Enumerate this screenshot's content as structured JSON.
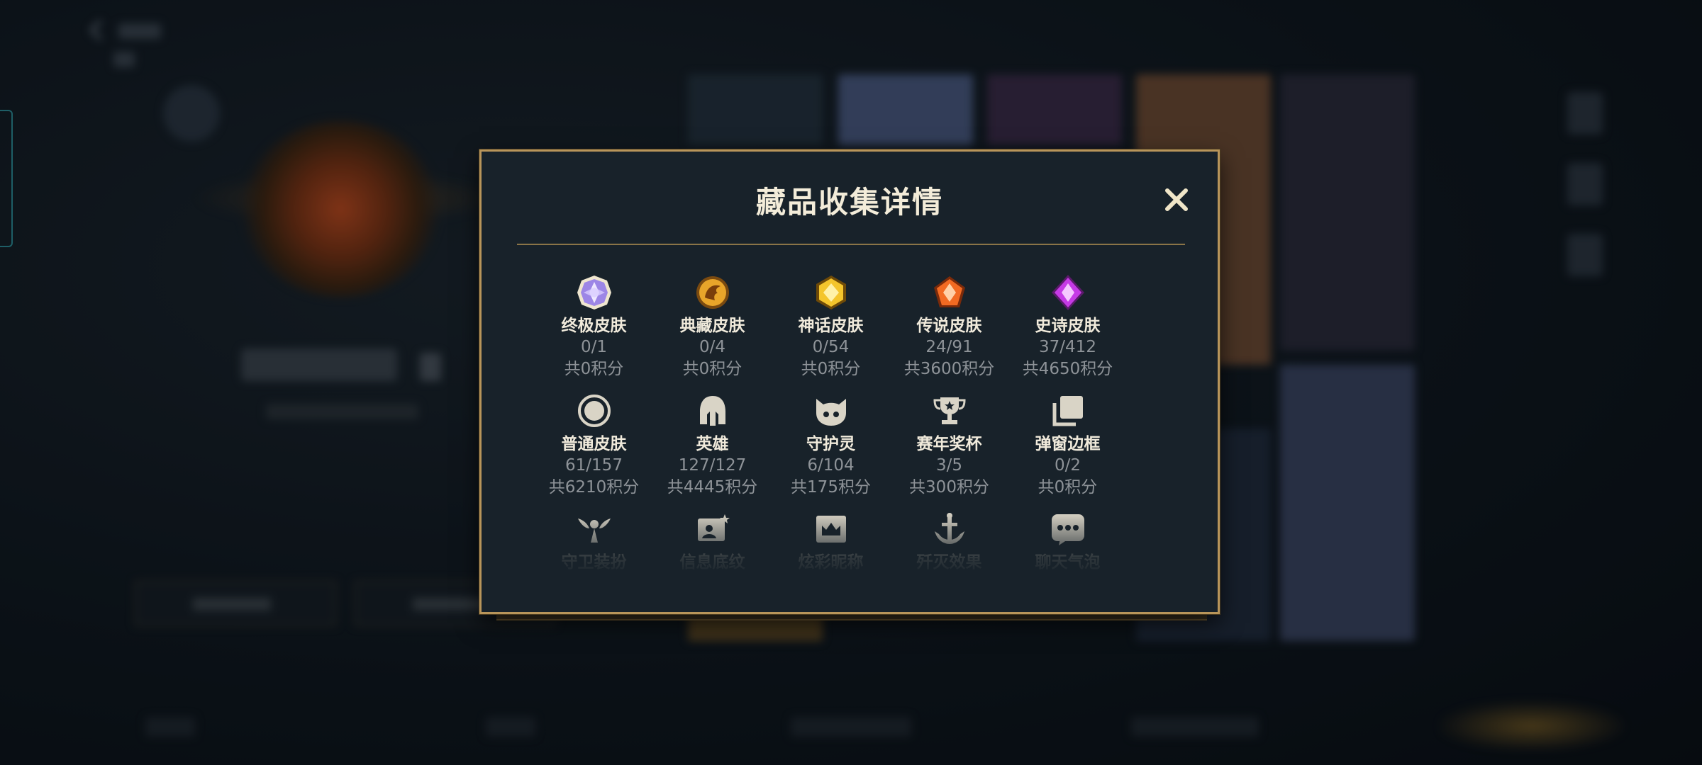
{
  "modal": {
    "title": "藏品收集详情",
    "close_icon": "close-icon"
  },
  "categories": [
    {
      "icon": "ultimate-skin-icon",
      "name": "终极皮肤",
      "count": "0/1",
      "points": "共0积分",
      "color": "#b49cf0"
    },
    {
      "icon": "collector-skin-icon",
      "name": "典藏皮肤",
      "count": "0/4",
      "points": "共0积分",
      "color": "#e0a32a"
    },
    {
      "icon": "mythic-skin-icon",
      "name": "神话皮肤",
      "count": "0/54",
      "points": "共0积分",
      "color": "#f2c12e"
    },
    {
      "icon": "legendary-skin-icon",
      "name": "传说皮肤",
      "count": "24/91",
      "points": "共3600积分",
      "color": "#f06a2a"
    },
    {
      "icon": "epic-skin-icon",
      "name": "史诗皮肤",
      "count": "37/412",
      "points": "共4650积分",
      "color": "#c24ae0"
    },
    {
      "icon": "normal-skin-icon",
      "name": "普通皮肤",
      "count": "61/157",
      "points": "共6210积分",
      "color": "#d9d4c6"
    },
    {
      "icon": "hero-helmet-icon",
      "name": "英雄",
      "count": "127/127",
      "points": "共4445积分",
      "color": "#d9d4c6"
    },
    {
      "icon": "guardian-spirit-icon",
      "name": "守护灵",
      "count": "6/104",
      "points": "共175积分",
      "color": "#d9d4c6"
    },
    {
      "icon": "season-trophy-icon",
      "name": "赛年奖杯",
      "count": "3/5",
      "points": "共300积分",
      "color": "#d9d4c6"
    },
    {
      "icon": "popup-frame-icon",
      "name": "弹窗边框",
      "count": "0/2",
      "points": "共0积分",
      "color": "#d9d4c6"
    },
    {
      "icon": "guardian-outfit-icon",
      "name": "守卫装扮",
      "count": "",
      "points": "",
      "color": "#d9d4c6"
    },
    {
      "icon": "info-background-icon",
      "name": "信息底纹",
      "count": "",
      "points": "",
      "color": "#d9d4c6"
    },
    {
      "icon": "colorful-nickname-icon",
      "name": "炫彩昵称",
      "count": "",
      "points": "",
      "color": "#d9d4c6"
    },
    {
      "icon": "kill-effect-icon",
      "name": "歼灭效果",
      "count": "",
      "points": "",
      "color": "#d9d4c6"
    },
    {
      "icon": "chat-bubble-icon",
      "name": "聊天气泡",
      "count": "",
      "points": "",
      "color": "#d9d4c6"
    }
  ],
  "colors": {
    "accent_gold": "#b8955a",
    "panel_bg": "#18222a"
  }
}
